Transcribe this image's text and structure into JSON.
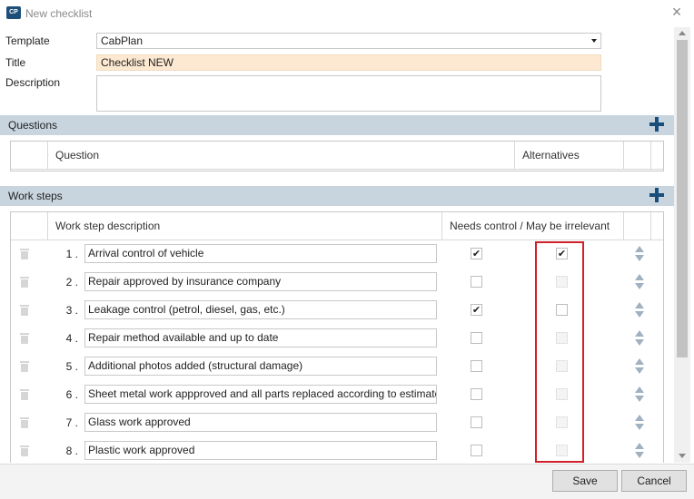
{
  "window": {
    "app_icon_text": "CP",
    "title": "New checklist",
    "close_icon": "close-icon"
  },
  "form": {
    "template_label": "Template",
    "template_value": "CabPlan",
    "title_label": "Title",
    "title_value": "Checklist NEW",
    "description_label": "Description",
    "description_value": ""
  },
  "questions": {
    "section_label": "Questions",
    "columns": [
      "Question",
      "Alternatives"
    ]
  },
  "work_steps": {
    "section_label": "Work steps",
    "columns": [
      "Work step description",
      "Needs control / May be irrelevant"
    ],
    "rows": [
      {
        "number": "1 .",
        "description": "Arrival control of vehicle",
        "needs_control": true,
        "may_be_irrelevant": true,
        "irrelevant_enabled": true
      },
      {
        "number": "2 .",
        "description": "Repair approved by insurance company",
        "needs_control": false,
        "may_be_irrelevant": false,
        "irrelevant_enabled": false
      },
      {
        "number": "3 .",
        "description": "Leakage control (petrol, diesel, gas, etc.)",
        "needs_control": true,
        "may_be_irrelevant": false,
        "irrelevant_enabled": true
      },
      {
        "number": "4 .",
        "description": "Repair method available and up to date",
        "needs_control": false,
        "may_be_irrelevant": false,
        "irrelevant_enabled": false
      },
      {
        "number": "5 .",
        "description": "Additional photos added (structural damage)",
        "needs_control": false,
        "may_be_irrelevant": false,
        "irrelevant_enabled": false
      },
      {
        "number": "6 .",
        "description": "Sheet metal work appproved and all parts replaced according to estimate",
        "needs_control": false,
        "may_be_irrelevant": false,
        "irrelevant_enabled": false
      },
      {
        "number": "7 .",
        "description": "Glass work approved",
        "needs_control": false,
        "may_be_irrelevant": false,
        "irrelevant_enabled": false
      },
      {
        "number": "8 .",
        "description": "Plastic work approved",
        "needs_control": false,
        "may_be_irrelevant": false,
        "irrelevant_enabled": false
      }
    ]
  },
  "footer": {
    "save_label": "Save",
    "cancel_label": "Cancel"
  },
  "colors": {
    "section_bar": "#c8d5df",
    "accent": "#1a4e7a",
    "title_field_bg": "#fde9d2",
    "highlight": "#d0202a"
  }
}
